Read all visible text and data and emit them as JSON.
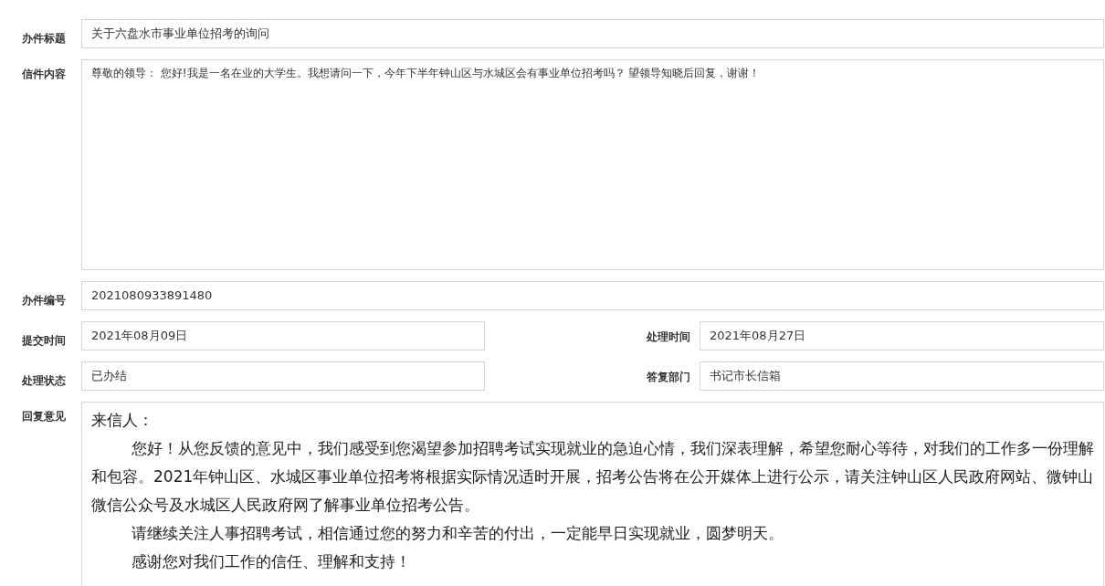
{
  "subject": {
    "label": "办件标题",
    "value": "关于六盘水市事业单位招考的询问"
  },
  "letter": {
    "label": "信件内容",
    "value": "尊敬的领导： 您好!我是一名在业的大学生。我想请问一下，今年下半年钟山区与水城区会有事业单位招考吗？ 望领导知晓后回复，谢谢！"
  },
  "case_number": {
    "label": "办件编号",
    "value": "2021080933891480"
  },
  "pairs": [
    [
      {
        "label": "提交时间",
        "value": "2021年08月09日"
      },
      {
        "label": "处理时间",
        "value": "2021年08月27日"
      }
    ],
    [
      {
        "label": "处理状态",
        "value": "已办结"
      },
      {
        "label": "答复部门",
        "value": "书记市长信箱"
      }
    ]
  ],
  "reply": {
    "label": "回复意见",
    "paragraphs": [
      {
        "kind": "salutation",
        "text": "来信人："
      },
      {
        "kind": "body",
        "text": "您好！从您反馈的意见中，我们感受到您渴望参加招聘考试实现就业的急迫心情，我们深表理解，希望您耐心等待，对我们的工作多一份理解和包容。2021年钟山区、水城区事业单位招考将根据实际情况适时开展，招考公告将在公开媒体上进行公示，请关注钟山区人民政府网站、微钟山微信公众号及水城区人民政府网了解事业单位招考公告。"
      },
      {
        "kind": "body",
        "text": "请继续关注人事招聘考试，相信通过您的努力和辛苦的付出，一定能早日实现就业，圆梦明天。"
      },
      {
        "kind": "body",
        "text": "感谢您对我们工作的信任、理解和支持！"
      }
    ]
  }
}
